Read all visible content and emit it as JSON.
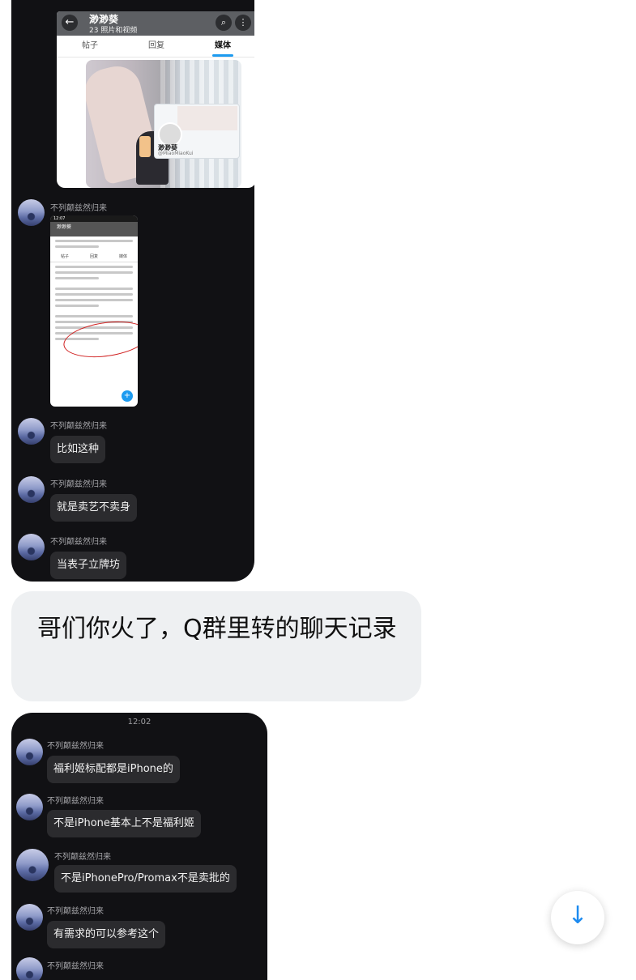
{
  "profile_card": {
    "back_icon": "arrow-left-icon",
    "name": "渺渺葵",
    "subtitle": "23 照片和视频",
    "tabs": [
      "帖子",
      "回复",
      "媒体"
    ],
    "active_tab": "媒体",
    "mini_name": "渺渺葵",
    "mini_handle": "@MiaoMiaoKui"
  },
  "chat1": {
    "messages": [
      {
        "sender": "不列颠兹然归来",
        "type": "image"
      },
      {
        "sender": "不列颠兹然归来",
        "text": "比如这种"
      },
      {
        "sender": "不列颠兹然归来",
        "text": "就是卖艺不卖身"
      },
      {
        "sender": "不列颠兹然归来",
        "text": "当表子立牌坊"
      }
    ],
    "embedded_screenshot": {
      "status_time": "12:07",
      "header_name": "渺渺葵",
      "tabs": [
        "帖子",
        "回复",
        "媒体"
      ]
    }
  },
  "outgoing": {
    "text": "哥们你火了，Q群里转的聊天记录"
  },
  "chat2": {
    "time": "12:02",
    "messages": [
      {
        "sender": "不列颠兹然归来",
        "text": "福利姬标配都是iPhone的"
      },
      {
        "sender": "不列颠兹然归来",
        "text": "不是iPhone基本上不是福利姬"
      },
      {
        "sender": "不列颠兹然归来",
        "text": "不是iPhonePro/Promax不是卖批的"
      },
      {
        "sender": "不列颠兹然归来",
        "text": "有需求的可以参考这个"
      },
      {
        "sender": "不列颠兹然归来"
      }
    ]
  },
  "scroll_down": {
    "icon": "arrow-down-icon",
    "glyph": "↓",
    "color": "#1d8bf0"
  }
}
